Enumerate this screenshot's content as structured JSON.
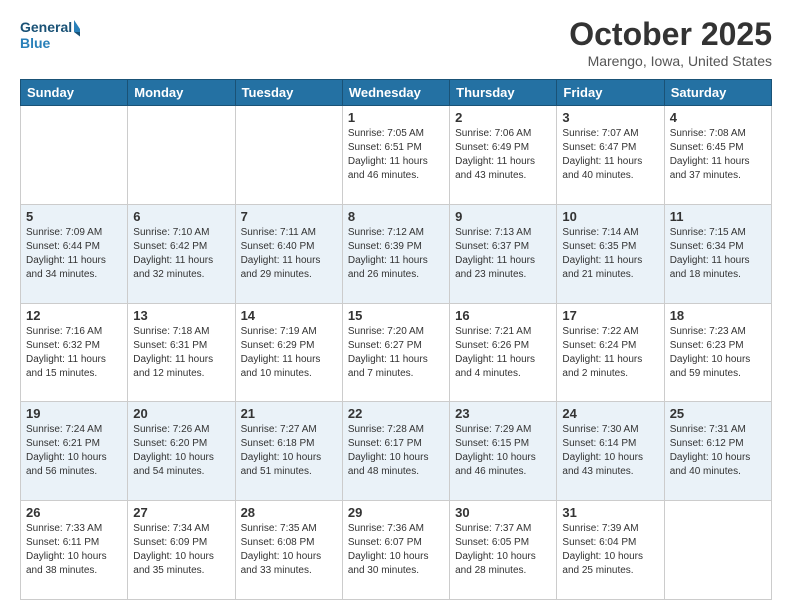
{
  "header": {
    "logo_line1": "General",
    "logo_line2": "Blue",
    "month": "October 2025",
    "location": "Marengo, Iowa, United States"
  },
  "days_of_week": [
    "Sunday",
    "Monday",
    "Tuesday",
    "Wednesday",
    "Thursday",
    "Friday",
    "Saturday"
  ],
  "weeks": [
    [
      {
        "day": "",
        "info": ""
      },
      {
        "day": "",
        "info": ""
      },
      {
        "day": "",
        "info": ""
      },
      {
        "day": "1",
        "info": "Sunrise: 7:05 AM\nSunset: 6:51 PM\nDaylight: 11 hours\nand 46 minutes."
      },
      {
        "day": "2",
        "info": "Sunrise: 7:06 AM\nSunset: 6:49 PM\nDaylight: 11 hours\nand 43 minutes."
      },
      {
        "day": "3",
        "info": "Sunrise: 7:07 AM\nSunset: 6:47 PM\nDaylight: 11 hours\nand 40 minutes."
      },
      {
        "day": "4",
        "info": "Sunrise: 7:08 AM\nSunset: 6:45 PM\nDaylight: 11 hours\nand 37 minutes."
      }
    ],
    [
      {
        "day": "5",
        "info": "Sunrise: 7:09 AM\nSunset: 6:44 PM\nDaylight: 11 hours\nand 34 minutes."
      },
      {
        "day": "6",
        "info": "Sunrise: 7:10 AM\nSunset: 6:42 PM\nDaylight: 11 hours\nand 32 minutes."
      },
      {
        "day": "7",
        "info": "Sunrise: 7:11 AM\nSunset: 6:40 PM\nDaylight: 11 hours\nand 29 minutes."
      },
      {
        "day": "8",
        "info": "Sunrise: 7:12 AM\nSunset: 6:39 PM\nDaylight: 11 hours\nand 26 minutes."
      },
      {
        "day": "9",
        "info": "Sunrise: 7:13 AM\nSunset: 6:37 PM\nDaylight: 11 hours\nand 23 minutes."
      },
      {
        "day": "10",
        "info": "Sunrise: 7:14 AM\nSunset: 6:35 PM\nDaylight: 11 hours\nand 21 minutes."
      },
      {
        "day": "11",
        "info": "Sunrise: 7:15 AM\nSunset: 6:34 PM\nDaylight: 11 hours\nand 18 minutes."
      }
    ],
    [
      {
        "day": "12",
        "info": "Sunrise: 7:16 AM\nSunset: 6:32 PM\nDaylight: 11 hours\nand 15 minutes."
      },
      {
        "day": "13",
        "info": "Sunrise: 7:18 AM\nSunset: 6:31 PM\nDaylight: 11 hours\nand 12 minutes."
      },
      {
        "day": "14",
        "info": "Sunrise: 7:19 AM\nSunset: 6:29 PM\nDaylight: 11 hours\nand 10 minutes."
      },
      {
        "day": "15",
        "info": "Sunrise: 7:20 AM\nSunset: 6:27 PM\nDaylight: 11 hours\nand 7 minutes."
      },
      {
        "day": "16",
        "info": "Sunrise: 7:21 AM\nSunset: 6:26 PM\nDaylight: 11 hours\nand 4 minutes."
      },
      {
        "day": "17",
        "info": "Sunrise: 7:22 AM\nSunset: 6:24 PM\nDaylight: 11 hours\nand 2 minutes."
      },
      {
        "day": "18",
        "info": "Sunrise: 7:23 AM\nSunset: 6:23 PM\nDaylight: 10 hours\nand 59 minutes."
      }
    ],
    [
      {
        "day": "19",
        "info": "Sunrise: 7:24 AM\nSunset: 6:21 PM\nDaylight: 10 hours\nand 56 minutes."
      },
      {
        "day": "20",
        "info": "Sunrise: 7:26 AM\nSunset: 6:20 PM\nDaylight: 10 hours\nand 54 minutes."
      },
      {
        "day": "21",
        "info": "Sunrise: 7:27 AM\nSunset: 6:18 PM\nDaylight: 10 hours\nand 51 minutes."
      },
      {
        "day": "22",
        "info": "Sunrise: 7:28 AM\nSunset: 6:17 PM\nDaylight: 10 hours\nand 48 minutes."
      },
      {
        "day": "23",
        "info": "Sunrise: 7:29 AM\nSunset: 6:15 PM\nDaylight: 10 hours\nand 46 minutes."
      },
      {
        "day": "24",
        "info": "Sunrise: 7:30 AM\nSunset: 6:14 PM\nDaylight: 10 hours\nand 43 minutes."
      },
      {
        "day": "25",
        "info": "Sunrise: 7:31 AM\nSunset: 6:12 PM\nDaylight: 10 hours\nand 40 minutes."
      }
    ],
    [
      {
        "day": "26",
        "info": "Sunrise: 7:33 AM\nSunset: 6:11 PM\nDaylight: 10 hours\nand 38 minutes."
      },
      {
        "day": "27",
        "info": "Sunrise: 7:34 AM\nSunset: 6:09 PM\nDaylight: 10 hours\nand 35 minutes."
      },
      {
        "day": "28",
        "info": "Sunrise: 7:35 AM\nSunset: 6:08 PM\nDaylight: 10 hours\nand 33 minutes."
      },
      {
        "day": "29",
        "info": "Sunrise: 7:36 AM\nSunset: 6:07 PM\nDaylight: 10 hours\nand 30 minutes."
      },
      {
        "day": "30",
        "info": "Sunrise: 7:37 AM\nSunset: 6:05 PM\nDaylight: 10 hours\nand 28 minutes."
      },
      {
        "day": "31",
        "info": "Sunrise: 7:39 AM\nSunset: 6:04 PM\nDaylight: 10 hours\nand 25 minutes."
      },
      {
        "day": "",
        "info": ""
      }
    ]
  ]
}
